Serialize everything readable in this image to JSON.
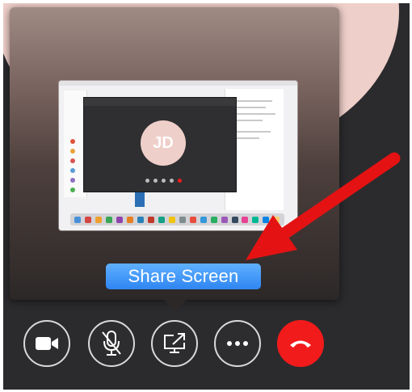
{
  "thumbnail": {
    "avatar_initials": "JD"
  },
  "share_button": {
    "label": "Share Screen"
  },
  "controls": [
    {
      "name": "video-camera",
      "icon": "video-camera-icon"
    },
    {
      "name": "microphone-muted",
      "icon": "microphone-muted-icon"
    },
    {
      "name": "share-screen",
      "icon": "share-screen-icon"
    },
    {
      "name": "more-options",
      "icon": "more-options-icon"
    },
    {
      "name": "end-call",
      "icon": "end-call-icon"
    }
  ],
  "colors": {
    "accent_blue": "#2f86f2",
    "end_call_red": "#f21b1b",
    "annotation_arrow_red": "#e41212",
    "avatar_pink": "#efcfc9",
    "background_dark": "#2b2b2e"
  }
}
